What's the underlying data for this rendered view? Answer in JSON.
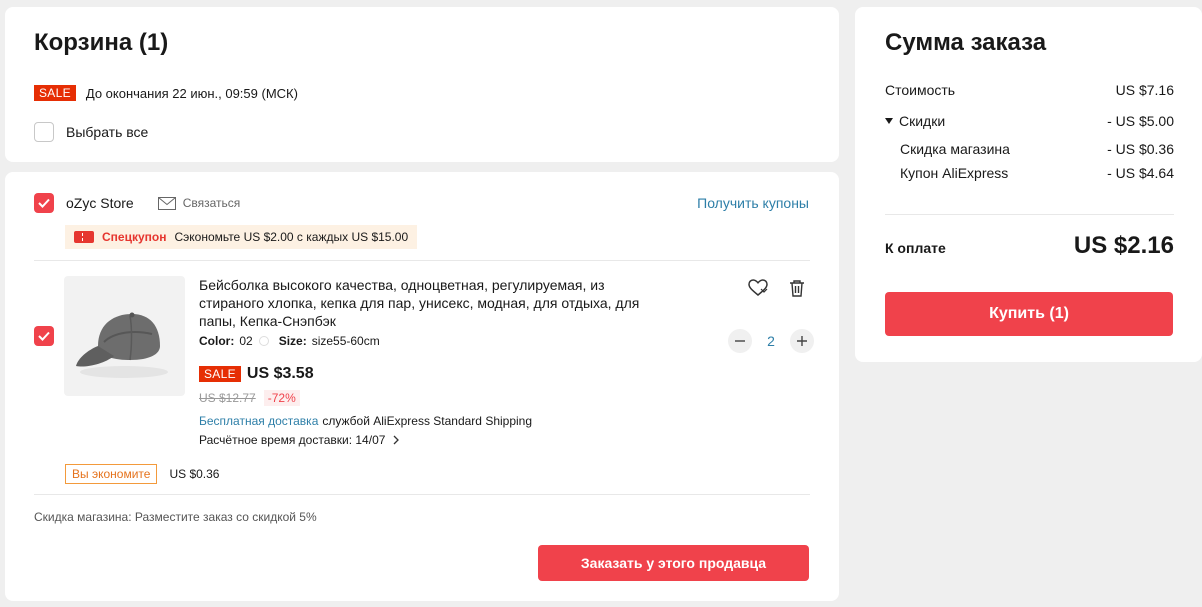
{
  "cart": {
    "title": "Корзина (1)",
    "sale_tag": "SALE",
    "sale_text": "До окончания 22 июн., 09:59 (МСК)",
    "select_all_label": "Выбрать все"
  },
  "store": {
    "name": "oZyc Store",
    "contact_label": "Связаться",
    "get_coupons_label": "Получить купоны",
    "coupon_label": "Спецкупон",
    "coupon_text": "Сэкономьте US $2.00 с каждых US $15.00",
    "store_discount_label": "Скидка магазина:",
    "store_discount_text": "Разместите заказ со скидкой 5%",
    "order_button_label": "Заказать у этого продавца"
  },
  "item": {
    "title": "Бейсболка высокого качества, одноцветная, регулируемая, из стираного хлопка, кепка для пар, унисекс, модная, для отдыха, для папы, Кепка-Снэпбэк",
    "color_label": "Color:",
    "color_value": "02",
    "size_label": "Size:",
    "size_value": "size55-60cm",
    "sale_tag": "SALE",
    "price": "US $3.58",
    "old_price": "US $12.77",
    "discount": "-72%",
    "free_shipping": "Бесплатная доставка",
    "shipping_service": "службой AliExpress Standard Shipping",
    "delivery_estimate": "Расчётное время доставки: 14/07",
    "quantity": "2",
    "savings_badge": "Вы экономите",
    "savings_value": "US $0.36"
  },
  "summary": {
    "title": "Сумма заказа",
    "cost_label": "Стоимость",
    "cost_value": "US $7.16",
    "discounts_label": "Скидки",
    "discounts_value": "- US $5.00",
    "store_discount_label": "Скидка магазина",
    "store_discount_value": "- US $0.36",
    "coupon_label": "Купон AliExpress",
    "coupon_value": "- US $4.64",
    "total_label": "К оплате",
    "total_value": "US $2.16",
    "buy_button_label": "Купить (1)"
  },
  "colors": {
    "accent": "#f0424b",
    "sale_red": "#e62e04",
    "link_blue": "#2e7fa8"
  },
  "icons": [
    "checkbox-icon",
    "mail-icon",
    "coupon-icon",
    "heart-icon",
    "trash-icon",
    "minus-icon",
    "plus-icon",
    "chevron-right-icon",
    "triangle-down-icon"
  ]
}
